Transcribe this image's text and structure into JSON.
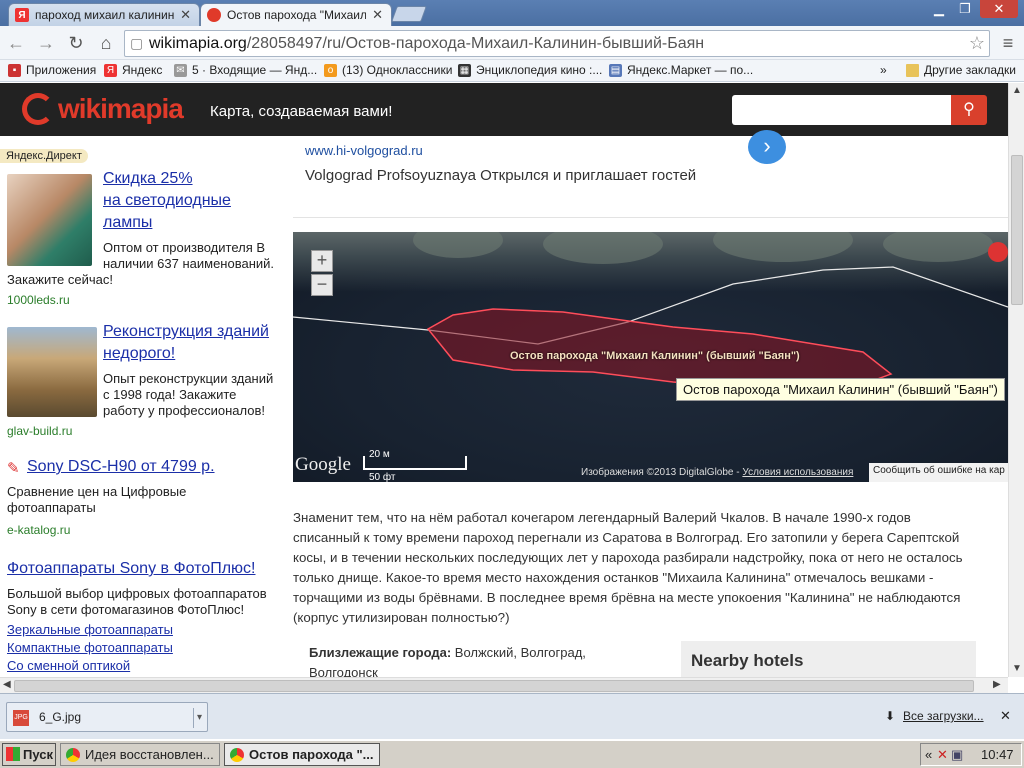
{
  "tabs": [
    {
      "title": "пароход михаил калинин —",
      "active": false
    },
    {
      "title": "Остов парохода \"Михаил К",
      "active": true
    }
  ],
  "address": {
    "host": "wikimapia.org",
    "path": "/28058497/ru/Остов-парохода-Михаил-Калинин-бывший-Баян"
  },
  "bookmarks": [
    "Приложения",
    "Яндекс",
    "5 · Входящие — Янд...",
    "(13) Одноклассники",
    "Энциклопедия кино :...",
    "Яндекс.Маркет — по...",
    "Другие закладки"
  ],
  "bookmarks_more": "»",
  "site": {
    "logo": "wikimapia",
    "tagline": "Карта, создаваемая вами!",
    "search_placeholder": ""
  },
  "ads": {
    "label": "Яндекс.Директ",
    "items": [
      {
        "title": "Скидка 25%\nна светодиодные\nлампы",
        "t1": "Скидка 25%",
        "t2": "на светодиодные",
        "t3": "лампы",
        "text1": "Оптом от производителя В",
        "text2": "наличии 637 наименований.",
        "text3": "Закажите сейчас!",
        "domain": "1000leds.ru"
      },
      {
        "t1": "Реконструкция зданий",
        "t2": "недорого!",
        "text1": "Опыт реконструкции зданий",
        "text2": "с 1998 года! Закажите",
        "text3": "работу у профессионалов!",
        "domain": "glav-build.ru"
      },
      {
        "t1": "Sony DSC-H90 от 4799 р.",
        "text1": "Сравнение цен на Цифровые",
        "text2": "фотоаппараты",
        "domain": "e-katalog.ru"
      },
      {
        "t1": "Фотоаппараты Sony в ФотоПлюс!",
        "text1": "Большой выбор цифровых фотоаппаратов",
        "text2": "Sony в сети фотомагазинов ФотоПлюс!",
        "links": [
          "Зеркальные фотоаппараты",
          "Компактные фотоаппараты",
          "Со сменной оптикой"
        ]
      }
    ]
  },
  "promo": {
    "url": "www.hi-volgograd.ru",
    "text": "Volgograd Profsoyuznaya Открылся и приглашает гостей"
  },
  "map": {
    "label": "Остов парохода \"Михаил Калинин\" (бывший \"Баян\")",
    "tooltip": "Остов парохода \"Михаил Калинин\" (бывший \"Баян\")",
    "scale_m": "20 м",
    "scale_ft": "50 фт",
    "google": "Google",
    "copyright": "Изображения ©2013 DigitalGlobe -",
    "terms": "Условия использования",
    "report": "Сообщить об ошибке на кар"
  },
  "description": [
    "Знаменит тем, что на нём работал кочегаром легендарный Валерий Чкалов. В начале 1990-х годов",
    "списанный к тому времени пароход перегнали из Саратова в Волгоград. Его затопили у берега Сарептской",
    "косы, и в течении нескольких последующих лет у парохода разбирали надстройку, пока от него не осталось",
    "только днище. Какое-то время место нахождения останков \"Михаила Калинина\" отмечалось вешками -",
    "торчащими из воды брёвнами. В последнее время брёвна на месте упокоения \"Калинина\" не наблюдаются",
    "(корпус утилизирован полностью?)"
  ],
  "nearby": {
    "label": "Близлежащие города:",
    "cities_line1": "Волжский, Волгоград,",
    "cities_line2": "Волгодонск"
  },
  "hotels_title": "Nearby hotels",
  "downloads": {
    "file": "6_G.jpg",
    "all": "Все загрузки..."
  },
  "taskbar": {
    "start": "Пуск",
    "items": [
      "Идея восстановлен...",
      "Остов парохода \"..."
    ],
    "time": "10:47"
  },
  "colors": {
    "brand": "#e03a2a",
    "link": "#1b2fa8",
    "ad_domain": "#2a7d2a",
    "polygon": "#ff4d5a"
  }
}
